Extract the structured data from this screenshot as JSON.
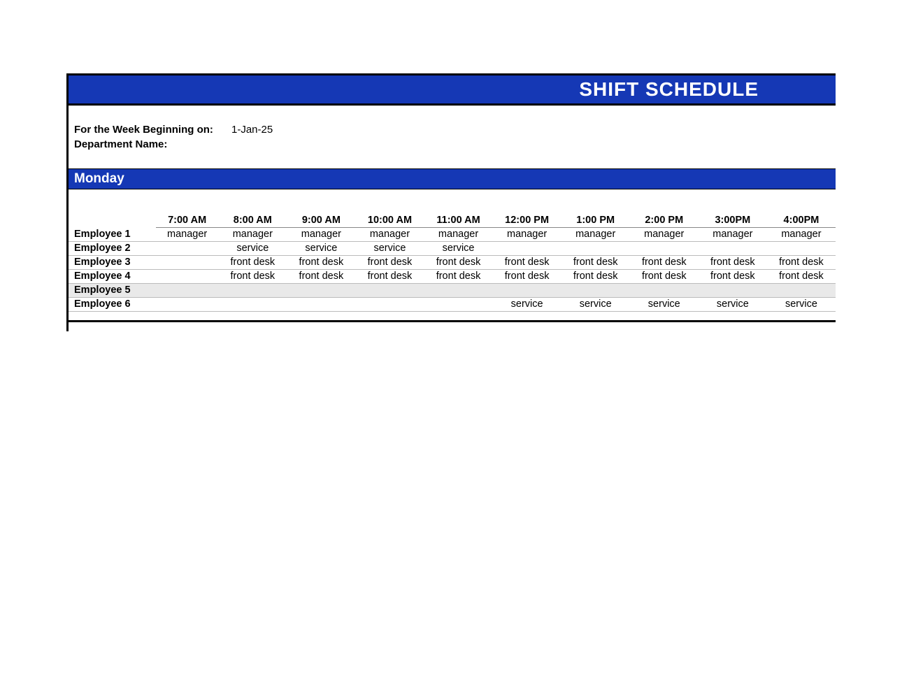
{
  "title": "SHIFT SCHEDULE",
  "meta": {
    "weekLabel": "For the Week Beginning on:",
    "weekValue": "1-Jan-25",
    "deptLabel": "Department Name:",
    "deptValue": ""
  },
  "day": "Monday",
  "hours": [
    "7:00 AM",
    "8:00 AM",
    "9:00 AM",
    "10:00 AM",
    "11:00 AM",
    "12:00 PM",
    "1:00 PM",
    "2:00 PM",
    "3:00PM",
    "4:00PM"
  ],
  "rows": [
    {
      "name": "Employee 1",
      "shade": false,
      "cells": [
        "manager",
        "manager",
        "manager",
        "manager",
        "manager",
        "manager",
        "manager",
        "manager",
        "manager",
        "manager"
      ]
    },
    {
      "name": "Employee 2",
      "shade": false,
      "cells": [
        "",
        "service",
        "service",
        "service",
        "service",
        "",
        "",
        "",
        "",
        ""
      ]
    },
    {
      "name": "Employee 3",
      "shade": false,
      "cells": [
        "",
        "front desk",
        "front desk",
        "front desk",
        "front desk",
        "front desk",
        "front desk",
        "front desk",
        "front desk",
        "front desk"
      ]
    },
    {
      "name": "Employee 4",
      "shade": false,
      "cells": [
        "",
        "front desk",
        "front desk",
        "front desk",
        "front desk",
        "front desk",
        "front desk",
        "front desk",
        "front desk",
        "front desk"
      ]
    },
    {
      "name": "Employee 5",
      "shade": true,
      "cells": [
        "",
        "",
        "",
        "",
        "",
        "",
        "",
        "",
        "",
        ""
      ]
    },
    {
      "name": "Employee 6",
      "shade": false,
      "cells": [
        "",
        "",
        "",
        "",
        "",
        "service",
        "service",
        "service",
        "service",
        "service"
      ]
    }
  ]
}
